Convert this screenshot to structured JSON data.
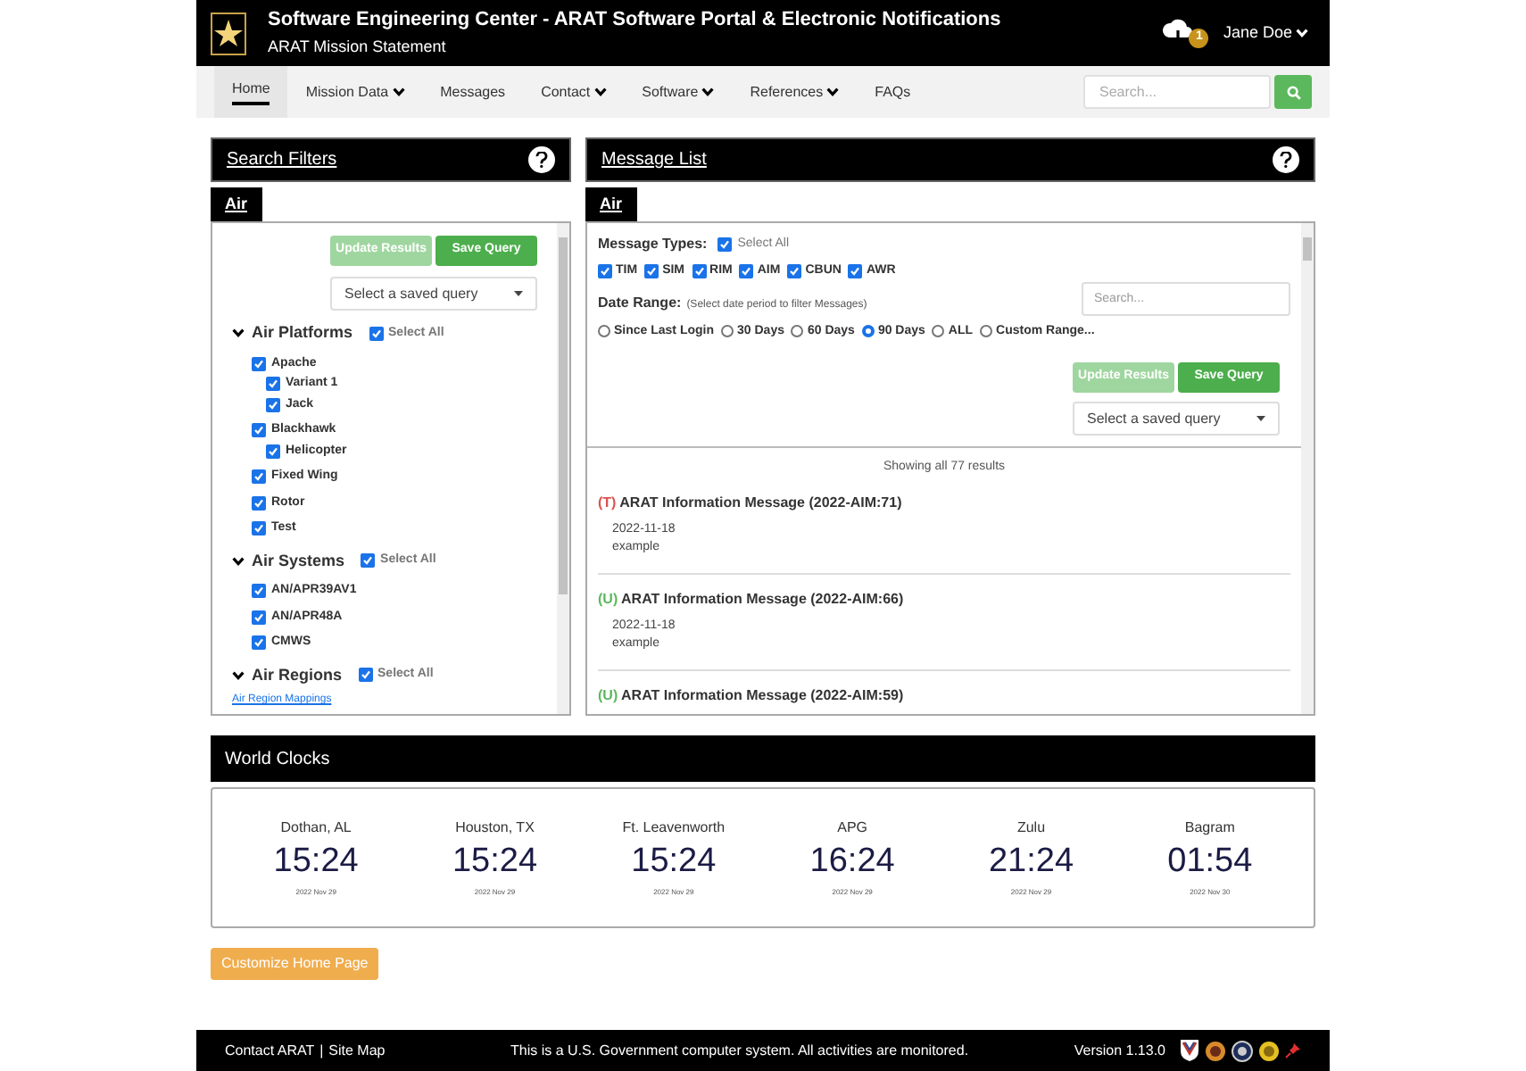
{
  "header": {
    "title": "Software Engineering Center - ARAT Software Portal & Electronic Notifications",
    "subtitle": "ARAT Mission Statement",
    "notification_count": "1",
    "user": "Jane Doe"
  },
  "nav": {
    "items": [
      {
        "label": "Home",
        "dropdown": false,
        "selected": true
      },
      {
        "label": "Mission Data",
        "dropdown": true,
        "selected": false
      },
      {
        "label": "Messages",
        "dropdown": false,
        "selected": false
      },
      {
        "label": "Contact",
        "dropdown": true,
        "selected": false
      },
      {
        "label": "Software",
        "dropdown": true,
        "selected": false
      },
      {
        "label": "References",
        "dropdown": true,
        "selected": false
      },
      {
        "label": "FAQs",
        "dropdown": false,
        "selected": false
      }
    ],
    "search_placeholder": "Search..."
  },
  "filters": {
    "title": "Search Filters",
    "tabs": [
      {
        "label": "Air",
        "selected": true
      }
    ],
    "buttons": [
      {
        "label": "Update Results",
        "disabled": true
      },
      {
        "label": "Save Query",
        "disabled": false
      }
    ],
    "saved_query_placeholder": "Select a saved query",
    "groups": [
      {
        "title": "Air Platforms",
        "expanded": true,
        "select_all": {
          "label": "Select All",
          "checked": true
        },
        "items": [
          {
            "label": "Apache",
            "checked": true,
            "children": [
              {
                "label": "Variant 1",
                "checked": true
              },
              {
                "label": "Jack",
                "checked": true
              }
            ]
          },
          {
            "label": "Blackhawk",
            "checked": true,
            "children": [
              {
                "label": "Helicopter",
                "checked": true
              }
            ]
          },
          {
            "label": "Fixed Wing",
            "checked": true
          },
          {
            "label": "Rotor",
            "checked": true
          },
          {
            "label": "Test",
            "checked": true
          }
        ]
      },
      {
        "title": "Air Systems",
        "expanded": true,
        "select_all": {
          "label": "Select All",
          "checked": true
        },
        "items": [
          {
            "label": "AN/APR39AV1",
            "checked": true
          },
          {
            "label": "AN/APR48A",
            "checked": true
          },
          {
            "label": "CMWS",
            "checked": true
          }
        ]
      },
      {
        "title": "Air Regions",
        "expanded": true,
        "select_all": {
          "label": "Select All",
          "checked": true
        },
        "link": "Air Region Mappings"
      }
    ]
  },
  "messages": {
    "title": "Message List",
    "tabs": [
      {
        "label": "Air",
        "selected": true
      }
    ],
    "types_label": "Message Types:",
    "select_all": {
      "label": "Select All",
      "checked": true
    },
    "types": [
      {
        "label": "TIM",
        "checked": true
      },
      {
        "label": "SIM",
        "checked": true
      },
      {
        "label": "RIM",
        "checked": true
      },
      {
        "label": "AIM",
        "checked": true
      },
      {
        "label": "CBUN",
        "checked": true
      },
      {
        "label": "AWR",
        "checked": true
      }
    ],
    "search_placeholder": "Search...",
    "date_label": "Date Range:",
    "date_hint": "(Select date period to filter Messages)",
    "ranges": [
      {
        "label": "Since Last Login",
        "selected": false
      },
      {
        "label": "30 Days",
        "selected": false
      },
      {
        "label": "60 Days",
        "selected": false
      },
      {
        "label": "90 Days",
        "selected": true
      },
      {
        "label": "ALL",
        "selected": false
      },
      {
        "label": "Custom Range...",
        "selected": false
      }
    ],
    "buttons": [
      {
        "label": "Update Results",
        "disabled": true
      },
      {
        "label": "Save Query",
        "disabled": false
      }
    ],
    "saved_query_placeholder": "Select a saved query",
    "results_text": "Showing all 77 results",
    "items": [
      {
        "tag": "(T)",
        "color": "#d9534f",
        "title": "ARAT Information Message (2022-AIM:71)",
        "date": "2022-11-18",
        "body": "example"
      },
      {
        "tag": "(U)",
        "color": "#5cb85c",
        "title": "ARAT Information Message (2022-AIM:66)",
        "date": "2022-11-18",
        "body": "example"
      },
      {
        "tag": "(U)",
        "color": "#5cb85c",
        "title": "ARAT Information Message (2022-AIM:59)"
      }
    ]
  },
  "clocks": {
    "title": "World Clocks",
    "items": [
      {
        "city": "Dothan, AL",
        "time": "15:24",
        "date": "2022 Nov 29"
      },
      {
        "city": "Houston, TX",
        "time": "15:24",
        "date": "2022 Nov 29"
      },
      {
        "city": "Ft. Leavenworth",
        "time": "15:24",
        "date": "2022 Nov 29"
      },
      {
        "city": "APG",
        "time": "16:24",
        "date": "2022 Nov 29"
      },
      {
        "city": "Zulu",
        "time": "21:24",
        "date": "2022 Nov 29"
      },
      {
        "city": "Bagram",
        "time": "01:54",
        "date": "2022 Nov 30"
      }
    ]
  },
  "customize_button": "Customize Home Page",
  "footer": {
    "links": [
      "Contact ARAT",
      "Site Map"
    ],
    "separator": "|",
    "notice": "This is a U.S. Government computer system. All activities are monitored.",
    "version": "Version 1.13.0"
  }
}
